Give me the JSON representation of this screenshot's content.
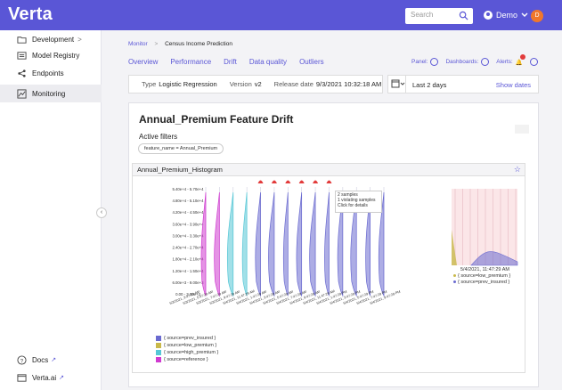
{
  "app": {
    "logo": "Verta"
  },
  "header": {
    "search_placeholder": "Search",
    "user_name": "Demo",
    "avatar_initial": "D"
  },
  "sidebar": {
    "items": [
      {
        "label": "Development",
        "icon": "folder-icon",
        "chevron": ">"
      },
      {
        "label": "Model Registry",
        "icon": "list-icon"
      },
      {
        "label": "Endpoints",
        "icon": "endpoints-icon"
      },
      {
        "label": "Monitoring",
        "icon": "chart-icon"
      }
    ],
    "footer": [
      {
        "label": "Docs",
        "icon": "help-icon"
      },
      {
        "label": "Verta.ai",
        "icon": "window-icon"
      }
    ]
  },
  "breadcrumb": {
    "root": "Monitor",
    "separator": ">",
    "current": "Census Income Prediction"
  },
  "tabs": [
    "Overview",
    "Performance",
    "Drift",
    "Data quality",
    "Outliers"
  ],
  "tools": {
    "panel": "Panel:",
    "dashboards": "Dashboards:",
    "alerts": "Alerts:"
  },
  "model_info": {
    "type_label": "Type",
    "type_value": "Logistic Regression",
    "version_label": "Version",
    "version_value": "v2",
    "release_label": "Release date",
    "release_value": "9/3/2021 10:32:18 AM"
  },
  "date_filter": {
    "range": "Last 2 days",
    "show_dates": "Show dates"
  },
  "card": {
    "title": "Annual_Premium Feature Drift",
    "filters_title": "Active filters",
    "filter_chip": "feature_name = Annual_Premium",
    "histogram_title": "Annual_Premium_Histogram"
  },
  "tooltip": {
    "line1": "2 samples",
    "line2": "1 violating samples",
    "line3": "Click for details"
  },
  "side_info": {
    "timestamp": "5/4/2021, 11:47:29 AM",
    "items": [
      {
        "label": "{ source=low_premium }",
        "color": "#c9b94a"
      },
      {
        "label": "{ source=prev_insured }",
        "color": "#6a6ad0"
      }
    ]
  },
  "chart_data": {
    "type": "violin",
    "y_ticks": [
      "5.40e+4 - 5.70e+4",
      "4.80e+4 - 5.10e+4",
      "4.20e+4 - 4.50e+4",
      "3.60e+4 - 3.90e+4",
      "3.00e+4 - 3.30e+4",
      "2.40e+4 - 2.70e+4",
      "1.80e+4 - 2.10e+4",
      "1.20e+4 - 1.50e+4",
      "6.00e+3 - 9.00e+3",
      "0.00 - 3.00e+3"
    ],
    "x_ticks": [
      "5/3/2021, 3:47:29 AM",
      "5/3/2021, 5:47:29 AM",
      "5/3/2021, 7:47:29 AM",
      "5/3/2021, 9:47:29 AM",
      "5/4/2021, 11:47:29 AM",
      "5/4/2021, 1:47:29 AM",
      "5/4/2021, 3:47:29 AM",
      "5/4/2021, 5:47:29 AM",
      "5/4/2021, 7:47:29 AM",
      "5/4/2021, 9:47:29 AM",
      "5/4/2021, 11:47:29 AM",
      "5/4/2021, 1:47:29 PM",
      "5/4/2021, 3:47:29 PM",
      "5/4/2021, 5:47:29 PM",
      "5/4/2021, 7:47:29 PM",
      "5/4/2021, 9:47:29 PM"
    ],
    "series": [
      {
        "name": "{ source=prev_insured }",
        "color": "#6a6ad0"
      },
      {
        "name": "{ source=low_premium }",
        "color": "#c9b94a"
      },
      {
        "name": "{ source=high_premium }",
        "color": "#55c7d6"
      },
      {
        "name": "{ source=reference }",
        "color": "#d03ad0"
      }
    ],
    "violins": [
      {
        "series": 3,
        "alert": false
      },
      {
        "series": 3,
        "alert": false
      },
      {
        "series": 2,
        "alert": false
      },
      {
        "series": 2,
        "alert": false
      },
      {
        "series": 0,
        "alert": true
      },
      {
        "series": 0,
        "alert": true
      },
      {
        "series": 0,
        "alert": true
      },
      {
        "series": 0,
        "alert": true
      },
      {
        "series": 0,
        "alert": true
      },
      {
        "series": 0,
        "alert": true
      },
      {
        "series": 0,
        "alert": false
      },
      {
        "series": 0,
        "alert": false
      },
      {
        "series": 0,
        "alert": false
      },
      {
        "series": 0,
        "alert": false
      }
    ]
  }
}
